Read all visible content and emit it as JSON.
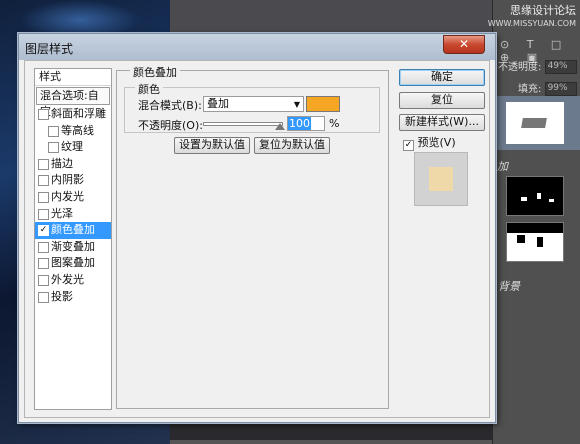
{
  "watermark": {
    "line1": "思缘设计论坛",
    "line2": "WWW.MISSYUAN.COM"
  },
  "ps_panel": {
    "opacity_label": "不透明度:",
    "opacity_value": "49%",
    "fill_label": "填充:",
    "fill_value": "99%",
    "layer_label_partial": "加",
    "background_layer": "背景"
  },
  "dialog": {
    "title": "图层样式",
    "close_glyph": "✕"
  },
  "styles_panel": {
    "header": "样式",
    "blend_options": "混合选项:自定",
    "items": [
      {
        "label": "斜面和浮雕",
        "checked": false,
        "sub": false,
        "selected": false
      },
      {
        "label": "等高线",
        "checked": false,
        "sub": true,
        "selected": false
      },
      {
        "label": "纹理",
        "checked": false,
        "sub": true,
        "selected": false
      },
      {
        "label": "描边",
        "checked": false,
        "sub": false,
        "selected": false
      },
      {
        "label": "内阴影",
        "checked": false,
        "sub": false,
        "selected": false
      },
      {
        "label": "内发光",
        "checked": false,
        "sub": false,
        "selected": false
      },
      {
        "label": "光泽",
        "checked": false,
        "sub": false,
        "selected": false
      },
      {
        "label": "颜色叠加",
        "checked": true,
        "sub": false,
        "selected": true
      },
      {
        "label": "渐变叠加",
        "checked": false,
        "sub": false,
        "selected": false
      },
      {
        "label": "图案叠加",
        "checked": false,
        "sub": false,
        "selected": false
      },
      {
        "label": "外发光",
        "checked": false,
        "sub": false,
        "selected": false
      },
      {
        "label": "投影",
        "checked": false,
        "sub": false,
        "selected": false
      }
    ]
  },
  "color_overlay": {
    "group_title": "颜色叠加",
    "subgroup_title": "颜色",
    "blend_mode_label": "混合模式(B):",
    "blend_mode_value": "叠加",
    "overlay_color": "#f5a623",
    "opacity_label": "不透明度(O):",
    "opacity_value": "100",
    "opacity_unit": "%",
    "opacity_fraction": 1.0,
    "set_default_button": "设置为默认值",
    "reset_default_button": "复位为默认值"
  },
  "right_panel": {
    "ok_button": "确定",
    "cancel_button": "复位",
    "new_style_button": "新建样式(W)...",
    "preview_label": "预览(V)",
    "preview_checked": true,
    "preview_color": "#efd9a8"
  }
}
